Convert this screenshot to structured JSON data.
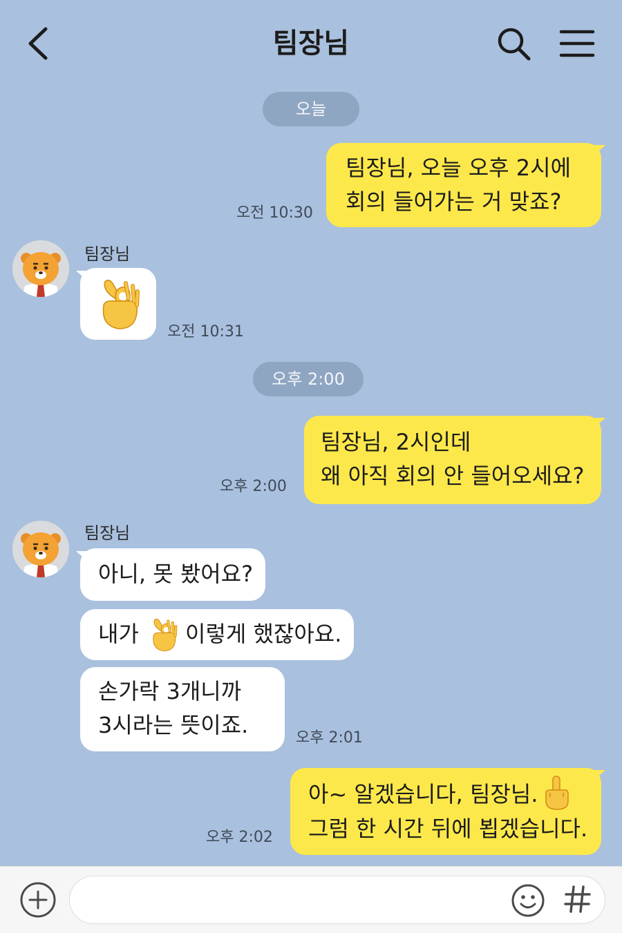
{
  "header": {
    "title": "팀장님"
  },
  "dates": {
    "today": "오늘",
    "afternoon": "오후 2:00"
  },
  "messages": {
    "m1": {
      "text": "팀장님, 오늘 오후 2시에\n회의 들어가는 거 맞죠?",
      "time": "오전 10:30"
    },
    "m2": {
      "sender": "팀장님",
      "emoji": "ok-hand",
      "time": "오전 10:31"
    },
    "m3": {
      "text": "팀장님, 2시인데\n왜 아직 회의 안 들어오세요?",
      "time": "오후 2:00"
    },
    "m4": {
      "sender": "팀장님",
      "text": "아니, 못 봤어요?"
    },
    "m5": {
      "text_before": "내가",
      "emoji": "ok-hand",
      "text_after": "이렇게 했잖아요."
    },
    "m6": {
      "text": "손가락 3개니까\n3시라는 뜻이죠.",
      "time": "오후 2:01"
    },
    "m7": {
      "line1": "아~ 알겠습니다, 팀장님.",
      "line2": "그럼 한 시간 뒤에 뵙겠습니다.",
      "emoji": "middle-finger",
      "time": "오후 2:02"
    }
  },
  "input": {
    "placeholder": ""
  },
  "colors": {
    "background": "#a9c0de",
    "outgoing_bubble": "#fde84b",
    "incoming_bubble": "#ffffff",
    "date_pill": "#8fa6c2"
  }
}
